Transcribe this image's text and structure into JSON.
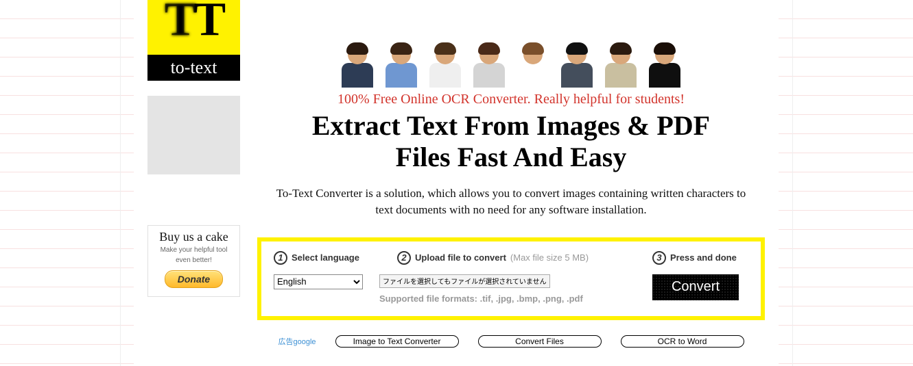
{
  "logo": {
    "tt": "TT",
    "brand": "to-text"
  },
  "sidebar": {
    "donate_title": "Buy us a cake",
    "donate_sub1": "Make your helpful tool",
    "donate_sub2": "even better!",
    "donate_button": "Donate"
  },
  "main": {
    "tagline": "100% Free Online OCR Converter. Really helpful for students!",
    "headline_l1": "Extract Text From Images & PDF",
    "headline_l2": "Files Fast And Easy",
    "description": "To-Text Converter is a solution, which allows you to convert images containing written characters to text documents with no need for any software installation."
  },
  "steps": {
    "s1": {
      "num": "1",
      "label": "Select language"
    },
    "s2": {
      "num": "2",
      "label": "Upload file to convert",
      "hint": "(Max file size 5 MB)"
    },
    "s3": {
      "num": "3",
      "label": "Press and done"
    },
    "language_value": "English",
    "upload_button": "ファイルを選択してもファイルが選択されていません",
    "upload_status": "",
    "supported": "Supported file formats: .tif, .jpg, .bmp, .png, .pdf",
    "convert_button": "Convert"
  },
  "ads": {
    "label": "広告google",
    "b1": "Image to Text Converter",
    "b2": "Convert Files",
    "b3": "OCR to Word"
  },
  "people": [
    {
      "hair": "#2b1a0f",
      "shirt": "#2d3c55"
    },
    {
      "hair": "#3a2414",
      "shirt": "#6f97d1"
    },
    {
      "hair": "#4a3019",
      "shirt": "#efefef"
    },
    {
      "hair": "#4a2a18",
      "shirt": "#d4d4d4"
    },
    {
      "hair": "#7a4f2b",
      "shirt": "#ffffff"
    },
    {
      "hair": "#111",
      "shirt": "#444e5c"
    },
    {
      "hair": "#2b1a0f",
      "shirt": "#c9bfa0"
    },
    {
      "hair": "#1a0e07",
      "shirt": "#0f0f0f"
    }
  ]
}
